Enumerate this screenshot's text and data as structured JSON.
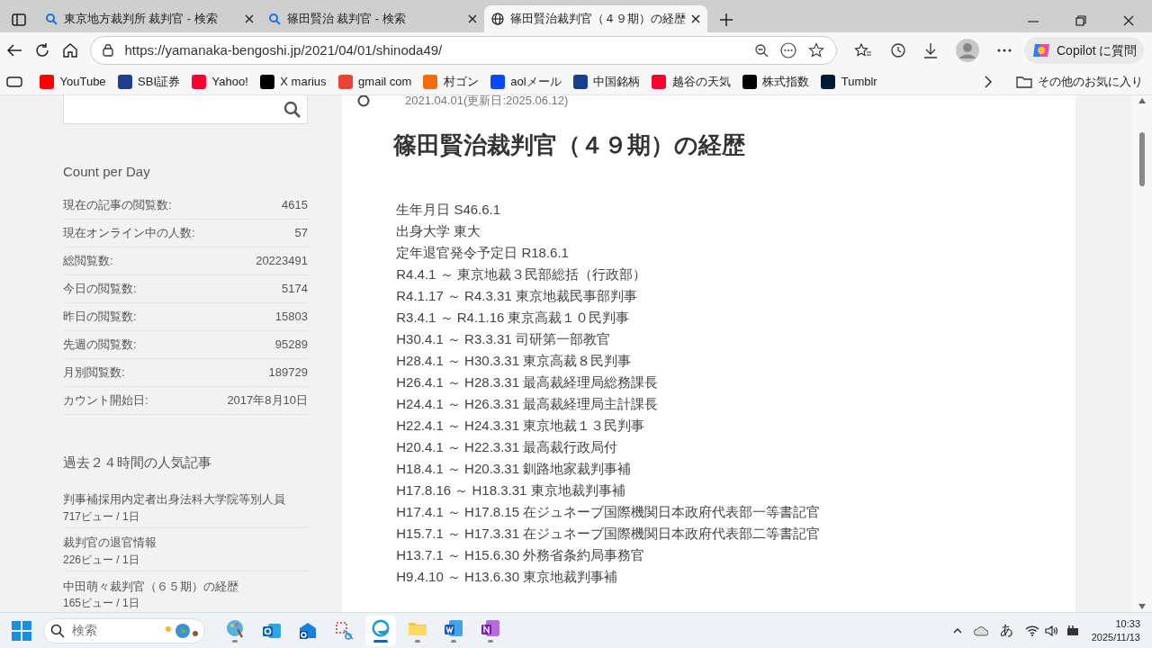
{
  "tabs": [
    {
      "title": "東京地方裁判所 裁判官 - 検索",
      "kind": "search",
      "selected": false
    },
    {
      "title": "篠田賢治 裁判官 - 検索",
      "kind": "search",
      "selected": false
    },
    {
      "title": "篠田賢治裁判官（４９期）の経歴",
      "kind": "page",
      "selected": true
    }
  ],
  "address_bar": {
    "url": "https://yamanaka-bengoshi.jp/2021/04/01/shinoda49/"
  },
  "copilot_button": "Copilot に質問",
  "bookmarks": [
    {
      "label": "YouTube",
      "color": "#ff0000"
    },
    {
      "label": "SBI証券",
      "color": "#1d3f8c"
    },
    {
      "label": "Yahoo!",
      "color": "#ff0033"
    },
    {
      "label": "X marius",
      "color": "#000000"
    },
    {
      "label": "gmail com",
      "color": "#ea4335"
    },
    {
      "label": "村ゴン",
      "color": "#f26b0f"
    },
    {
      "label": "aolメール",
      "color": "#0a47ff"
    },
    {
      "label": "中国銘柄",
      "color": "#1b3f8f"
    },
    {
      "label": "越谷の天気",
      "color": "#ff0033"
    },
    {
      "label": "株式指数",
      "color": "#000000"
    },
    {
      "label": "Tumblr",
      "color": "#001935"
    }
  ],
  "other_bookmarks": "その他のお気に入り",
  "sidebar": {
    "count_title": "Count per Day",
    "counts": [
      {
        "label": "現在の記事の閲覧数:",
        "value": "4615"
      },
      {
        "label": "現在オンライン中の人数:",
        "value": "57"
      },
      {
        "label": "総閲覧数:",
        "value": "20223491"
      },
      {
        "label": "今日の閲覧数:",
        "value": "5174"
      },
      {
        "label": "昨日の閲覧数:",
        "value": "15803"
      },
      {
        "label": "先週の閲覧数:",
        "value": "95289"
      },
      {
        "label": "月別閲覧数:",
        "value": "189729"
      },
      {
        "label": "カウント開始日:",
        "value": "2017年8月10日"
      }
    ],
    "popular_title": "過去２４時間の人気記事",
    "popular": [
      {
        "title": "判事補採用内定者出身法科大学院等別人員",
        "views": "717ビュー / 1日"
      },
      {
        "title": "裁判官の退官情報",
        "views": "226ビュー / 1日"
      },
      {
        "title": "中田萌々裁判官（６５期）の経歴",
        "views": "165ビュー / 1日"
      }
    ]
  },
  "article": {
    "date": "2021.04.01(更新日:2025.06.12)",
    "title": "篠田賢治裁判官（４９期）の経歴",
    "lines": [
      "生年月日 S46.6.1",
      "出身大学 東大",
      "定年退官発令予定日 R18.6.1",
      "R4.4.1 ～ 東京地裁３民部総括（行政部）",
      "R4.1.17 ～ R4.3.31 東京地裁民事部判事",
      "R3.4.1 ～ R4.1.16 東京高裁１０民判事",
      "H30.4.1 ～ R3.3.31 司研第一部教官",
      "H28.4.1 ～ H30.3.31 東京高裁８民判事",
      "H26.4.1 ～ H28.3.31 最高裁経理局総務課長",
      "H24.4.1 ～ H26.3.31 最高裁経理局主計課長",
      "H22.4.1 ～ H24.3.31 東京地裁１３民判事",
      "H20.4.1 ～ H22.3.31 最高裁行政局付",
      "H18.4.1 ～ H20.3.31 釧路地家裁判事補",
      "H17.8.16 ～ H18.3.31 東京地裁判事補",
      "H17.4.1 ～ H17.8.15 在ジュネーブ国際機関日本政府代表部一等書記官",
      "H15.7.1 ～ H17.3.31 在ジュネーブ国際機関日本政府代表部二等書記官",
      "H13.7.1 ～ H15.6.30 外務省条約局事務官",
      "H9.4.10 ～ H13.6.30 東京地裁判事補"
    ]
  },
  "taskbar": {
    "search_placeholder": "検索",
    "apps": [
      {
        "kind": "paint",
        "active": false,
        "running": true
      },
      {
        "kind": "outlook",
        "active": false,
        "running": false
      },
      {
        "kind": "outlook-new",
        "active": false,
        "running": false
      },
      {
        "kind": "snip",
        "active": false,
        "running": false
      },
      {
        "kind": "edge",
        "active": true,
        "running": true
      },
      {
        "kind": "explorer",
        "active": false,
        "running": true
      },
      {
        "kind": "word",
        "active": false,
        "running": true
      },
      {
        "kind": "onenote",
        "active": false,
        "running": true
      }
    ],
    "ime": "あ",
    "time": "10:33",
    "date": "2025/11/13"
  }
}
